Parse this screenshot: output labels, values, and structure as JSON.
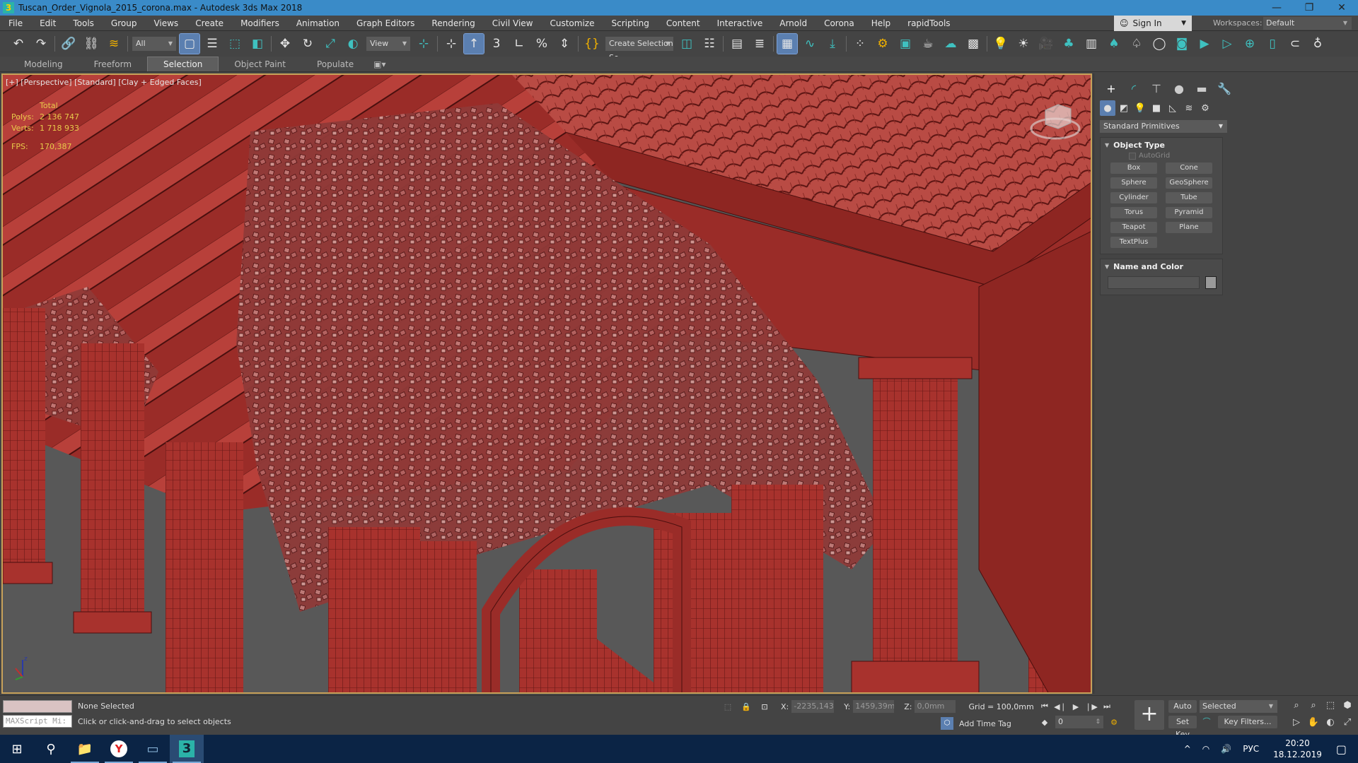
{
  "window": {
    "title": "Tuscan_Order_Vignola_2015_corona.max - Autodesk 3ds Max 2018",
    "app_icon": "3",
    "controls": {
      "minimize": "—",
      "restore": "❐",
      "close": "✕"
    }
  },
  "menu": [
    "File",
    "Edit",
    "Tools",
    "Group",
    "Views",
    "Create",
    "Modifiers",
    "Animation",
    "Graph Editors",
    "Rendering",
    "Civil View",
    "Customize",
    "Scripting",
    "Content",
    "Interactive",
    "Arnold",
    "Corona",
    "Help",
    "rapidTools"
  ],
  "account": {
    "sign_in": "Sign In",
    "workspaces_label": "Workspaces:",
    "workspace": "Default"
  },
  "toolbar": {
    "selection_filter": "All",
    "ref_coord": "View",
    "named_selection": "Create Selection Se",
    "icons": {
      "undo": "↶",
      "redo": "↷",
      "link": "🔗",
      "unlink": "⛓",
      "bind": "≋",
      "select": "▢",
      "select_by_name": "☰",
      "rect_region": "⬚",
      "window_crossing": "◧",
      "move": "✥",
      "rotate": "↻",
      "scale": "⤢",
      "placement": "◐",
      "pivot": "⊹",
      "snaps_toggle": "↑",
      "snap3": "3",
      "angle_snap": "∟",
      "percent_snap": "%",
      "spinner_snap": "⇕",
      "edit_named": "{}",
      "mirror": "◫",
      "align": "☷",
      "scene_explorer": "▤",
      "layer_explorer": "≣",
      "ribbon_toggle": "▦",
      "curve_editor": "∿",
      "schematic": "⤓",
      "material_editor": "⁘",
      "render_setup": "⚙",
      "rendered_frame": "▣",
      "render": "☕",
      "render_cloud": "☁",
      "a360": "▩",
      "light": "💡",
      "sun": "☀",
      "camera": "🎥",
      "forest": "♣",
      "table": "▥",
      "tree": "♠",
      "tree2": "♤",
      "ring": "◯",
      "image": "◙",
      "vframe": "▶",
      "vframe2": "▷",
      "cam_add": "⊕",
      "panel": "▯",
      "teapot": "⊂",
      "bulb": "♁"
    }
  },
  "ribbon": {
    "tabs": [
      "Modeling",
      "Freeform",
      "Selection",
      "Object Paint",
      "Populate"
    ],
    "active": "Selection"
  },
  "viewport": {
    "label": "[+] [Perspective] [Standard] [Clay + Edged Faces]",
    "stats": {
      "header": "Total",
      "polys_label": "Polys:",
      "polys": "2 136 747",
      "verts_label": "Verts:",
      "verts": "1 718 933",
      "fps_label": "FPS:",
      "fps": "170,387"
    },
    "axis": {
      "z": "z"
    },
    "colors": {
      "border": "#c8a25a",
      "stats_text": "#e8c94a",
      "model": "#8a2522"
    }
  },
  "command_panel": {
    "tabs": {
      "create": "+",
      "modify": "◜",
      "hierarchy": "⊤",
      "motion": "●",
      "display": "▬",
      "utilities": "🔧"
    },
    "categories": {
      "geometry": "●",
      "shapes": "◩",
      "lights": "💡",
      "cameras": "■",
      "helpers": "◺",
      "spacewarps": "≋",
      "systems": "⚙"
    },
    "dropdown": "Standard Primitives",
    "object_type": {
      "title": "Object Type",
      "autogrid": "AutoGrid",
      "buttons": [
        "Box",
        "Cone",
        "Sphere",
        "GeoSphere",
        "Cylinder",
        "Tube",
        "Torus",
        "Pyramid",
        "Teapot",
        "Plane",
        "TextPlus"
      ]
    },
    "name_color": {
      "title": "Name and Color",
      "name": "",
      "color": "#9a9a9a"
    }
  },
  "status": {
    "maxscript": "MAXScript Mi:",
    "selection": "None Selected",
    "prompt": "Click or click-and-drag to select objects",
    "x_label": "X:",
    "x": "-2235,143r",
    "y_label": "Y:",
    "y": "1459,39mm",
    "z_label": "Z:",
    "z": "0,0mm",
    "grid": "Grid = 100,0mm",
    "time_tag": "Add Time Tag"
  },
  "animation": {
    "frame": "0",
    "auto_key": "Auto Key",
    "set_key": "Set Key",
    "key_mode": "Selected",
    "key_filters": "Key Filters...",
    "icons": {
      "goto_start": "⏮",
      "prev": "◀❘",
      "play": "▶",
      "next": "❘▶",
      "goto_end": "⏭",
      "keymode": "◆",
      "time_config": "⚙"
    }
  },
  "nav": [
    "⌕",
    "⌕",
    "⬚",
    "⬢",
    "▷",
    "✋",
    "◐",
    "⤢"
  ],
  "taskbar": {
    "apps": {
      "start": "⊞",
      "search": "⚲",
      "explorer": "📁",
      "yandex": "Y",
      "photos": "▭",
      "max": "3"
    },
    "tray": {
      "chevron": "^",
      "wifi": "◠",
      "volume": "🔊",
      "lang": "РУС",
      "time": "20:20",
      "date": "18.12.2019",
      "notifications": "▢"
    }
  }
}
